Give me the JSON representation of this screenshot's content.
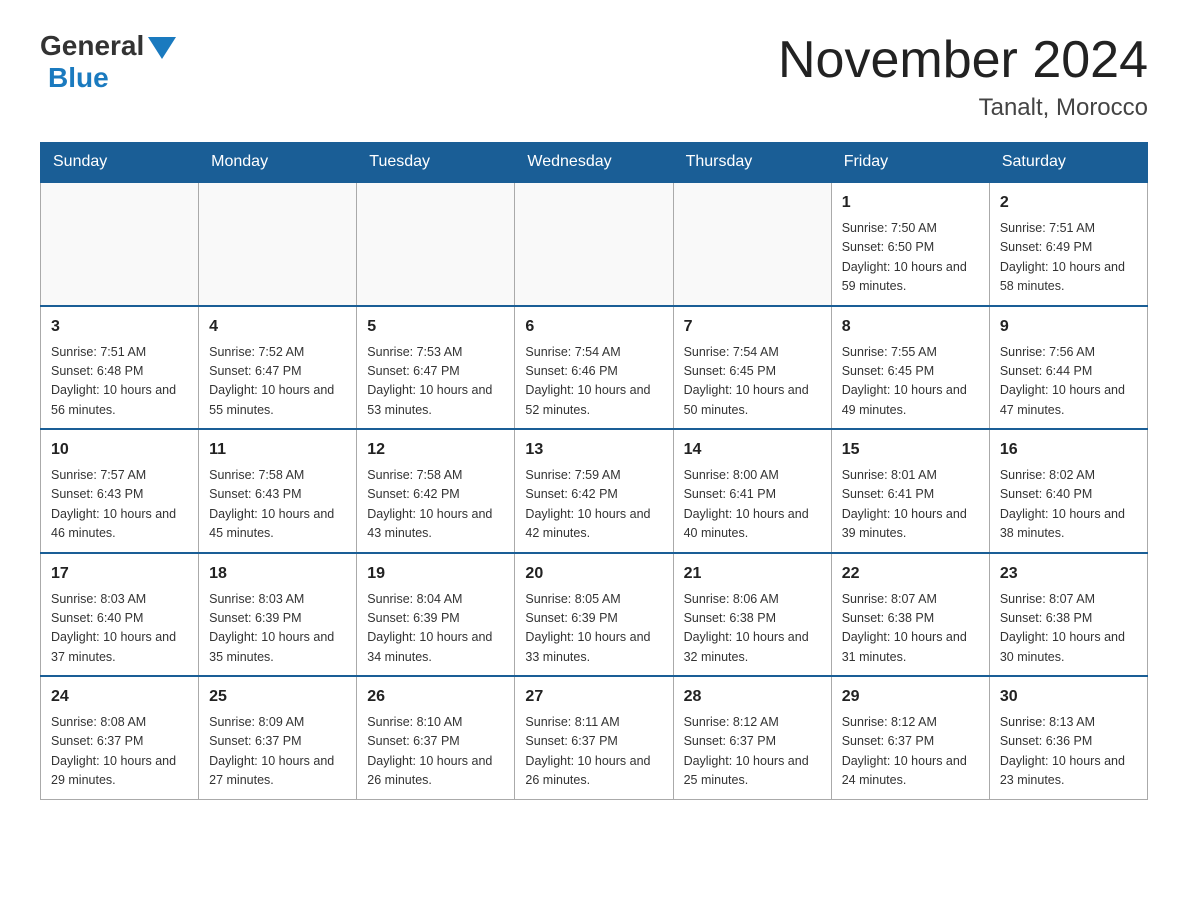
{
  "header": {
    "logo_general": "General",
    "logo_blue": "Blue",
    "month_title": "November 2024",
    "location": "Tanalt, Morocco"
  },
  "calendar": {
    "days_of_week": [
      "Sunday",
      "Monday",
      "Tuesday",
      "Wednesday",
      "Thursday",
      "Friday",
      "Saturday"
    ],
    "weeks": [
      [
        {
          "day": "",
          "info": ""
        },
        {
          "day": "",
          "info": ""
        },
        {
          "day": "",
          "info": ""
        },
        {
          "day": "",
          "info": ""
        },
        {
          "day": "",
          "info": ""
        },
        {
          "day": "1",
          "info": "Sunrise: 7:50 AM\nSunset: 6:50 PM\nDaylight: 10 hours and 59 minutes."
        },
        {
          "day": "2",
          "info": "Sunrise: 7:51 AM\nSunset: 6:49 PM\nDaylight: 10 hours and 58 minutes."
        }
      ],
      [
        {
          "day": "3",
          "info": "Sunrise: 7:51 AM\nSunset: 6:48 PM\nDaylight: 10 hours and 56 minutes."
        },
        {
          "day": "4",
          "info": "Sunrise: 7:52 AM\nSunset: 6:47 PM\nDaylight: 10 hours and 55 minutes."
        },
        {
          "day": "5",
          "info": "Sunrise: 7:53 AM\nSunset: 6:47 PM\nDaylight: 10 hours and 53 minutes."
        },
        {
          "day": "6",
          "info": "Sunrise: 7:54 AM\nSunset: 6:46 PM\nDaylight: 10 hours and 52 minutes."
        },
        {
          "day": "7",
          "info": "Sunrise: 7:54 AM\nSunset: 6:45 PM\nDaylight: 10 hours and 50 minutes."
        },
        {
          "day": "8",
          "info": "Sunrise: 7:55 AM\nSunset: 6:45 PM\nDaylight: 10 hours and 49 minutes."
        },
        {
          "day": "9",
          "info": "Sunrise: 7:56 AM\nSunset: 6:44 PM\nDaylight: 10 hours and 47 minutes."
        }
      ],
      [
        {
          "day": "10",
          "info": "Sunrise: 7:57 AM\nSunset: 6:43 PM\nDaylight: 10 hours and 46 minutes."
        },
        {
          "day": "11",
          "info": "Sunrise: 7:58 AM\nSunset: 6:43 PM\nDaylight: 10 hours and 45 minutes."
        },
        {
          "day": "12",
          "info": "Sunrise: 7:58 AM\nSunset: 6:42 PM\nDaylight: 10 hours and 43 minutes."
        },
        {
          "day": "13",
          "info": "Sunrise: 7:59 AM\nSunset: 6:42 PM\nDaylight: 10 hours and 42 minutes."
        },
        {
          "day": "14",
          "info": "Sunrise: 8:00 AM\nSunset: 6:41 PM\nDaylight: 10 hours and 40 minutes."
        },
        {
          "day": "15",
          "info": "Sunrise: 8:01 AM\nSunset: 6:41 PM\nDaylight: 10 hours and 39 minutes."
        },
        {
          "day": "16",
          "info": "Sunrise: 8:02 AM\nSunset: 6:40 PM\nDaylight: 10 hours and 38 minutes."
        }
      ],
      [
        {
          "day": "17",
          "info": "Sunrise: 8:03 AM\nSunset: 6:40 PM\nDaylight: 10 hours and 37 minutes."
        },
        {
          "day": "18",
          "info": "Sunrise: 8:03 AM\nSunset: 6:39 PM\nDaylight: 10 hours and 35 minutes."
        },
        {
          "day": "19",
          "info": "Sunrise: 8:04 AM\nSunset: 6:39 PM\nDaylight: 10 hours and 34 minutes."
        },
        {
          "day": "20",
          "info": "Sunrise: 8:05 AM\nSunset: 6:39 PM\nDaylight: 10 hours and 33 minutes."
        },
        {
          "day": "21",
          "info": "Sunrise: 8:06 AM\nSunset: 6:38 PM\nDaylight: 10 hours and 32 minutes."
        },
        {
          "day": "22",
          "info": "Sunrise: 8:07 AM\nSunset: 6:38 PM\nDaylight: 10 hours and 31 minutes."
        },
        {
          "day": "23",
          "info": "Sunrise: 8:07 AM\nSunset: 6:38 PM\nDaylight: 10 hours and 30 minutes."
        }
      ],
      [
        {
          "day": "24",
          "info": "Sunrise: 8:08 AM\nSunset: 6:37 PM\nDaylight: 10 hours and 29 minutes."
        },
        {
          "day": "25",
          "info": "Sunrise: 8:09 AM\nSunset: 6:37 PM\nDaylight: 10 hours and 27 minutes."
        },
        {
          "day": "26",
          "info": "Sunrise: 8:10 AM\nSunset: 6:37 PM\nDaylight: 10 hours and 26 minutes."
        },
        {
          "day": "27",
          "info": "Sunrise: 8:11 AM\nSunset: 6:37 PM\nDaylight: 10 hours and 26 minutes."
        },
        {
          "day": "28",
          "info": "Sunrise: 8:12 AM\nSunset: 6:37 PM\nDaylight: 10 hours and 25 minutes."
        },
        {
          "day": "29",
          "info": "Sunrise: 8:12 AM\nSunset: 6:37 PM\nDaylight: 10 hours and 24 minutes."
        },
        {
          "day": "30",
          "info": "Sunrise: 8:13 AM\nSunset: 6:36 PM\nDaylight: 10 hours and 23 minutes."
        }
      ]
    ]
  }
}
